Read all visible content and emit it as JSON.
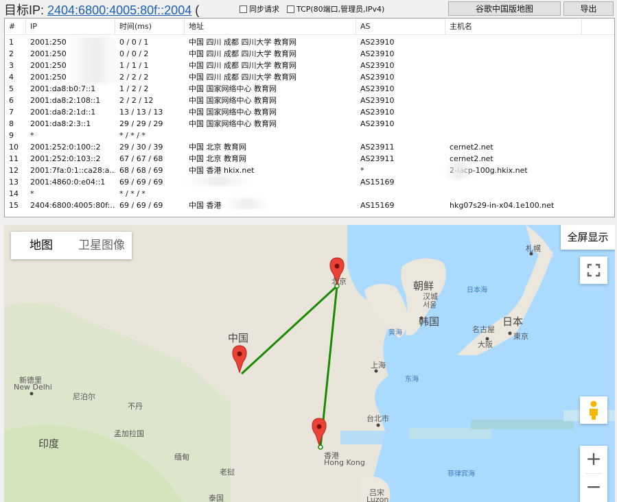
{
  "header": {
    "target_prefix": "目标IP: ",
    "target_ip": "2404:6800:4005:80f::2004",
    "target_suffix": " (",
    "sync_label": "同步请求",
    "tcp_label": "TCP(80端口,管理员,IPv4)",
    "map_button": "谷歌中国版地图",
    "export_button": "导出"
  },
  "table": {
    "columns": [
      "#",
      "IP",
      "时间(ms)",
      "地址",
      "AS",
      "主机名"
    ],
    "rows": [
      {
        "n": "1",
        "ip": "2001:250",
        "time": "0 / 0 / 1",
        "addr": "中国 四川 成都 四川大学 教育网",
        "as": "AS23910",
        "host": ""
      },
      {
        "n": "2",
        "ip": "2001:250",
        "time": "0 / 0 / 2",
        "addr": "中国 四川 成都 四川大学 教育网",
        "as": "AS23910",
        "host": ""
      },
      {
        "n": "3",
        "ip": "2001:250",
        "time": "1 / 1 / 1",
        "addr": "中国 四川 成都 四川大学 教育网",
        "as": "AS23910",
        "host": ""
      },
      {
        "n": "4",
        "ip": "2001:250",
        "time": "2 / 2 / 2",
        "addr": "中国 四川 成都 四川大学 教育网",
        "as": "AS23910",
        "host": ""
      },
      {
        "n": "5",
        "ip": "2001:da8:b0:7::1",
        "time": "1 / 2 / 2",
        "addr": "中国 国家网络中心 教育网",
        "as": "AS23910",
        "host": ""
      },
      {
        "n": "6",
        "ip": "2001:da8:2:108::1",
        "time": "2 / 2 / 12",
        "addr": "中国 国家网络中心 教育网",
        "as": "AS23910",
        "host": ""
      },
      {
        "n": "7",
        "ip": "2001:da8:2:1d::1",
        "time": "13 / 13 / 13",
        "addr": "中国 国家网络中心 教育网",
        "as": "AS23910",
        "host": ""
      },
      {
        "n": "8",
        "ip": "2001:da8:2:3::1",
        "time": "29 / 29 / 29",
        "addr": "中国 国家网络中心 教育网",
        "as": "AS23910",
        "host": ""
      },
      {
        "n": "9",
        "ip": "*",
        "time": "* / * / *",
        "addr": "",
        "as": "",
        "host": ""
      },
      {
        "n": "10",
        "ip": "2001:252:0:100::2",
        "time": "29 / 30 / 39",
        "addr": "中国 北京 教育网",
        "as": "AS23911",
        "host": "cernet2.net"
      },
      {
        "n": "11",
        "ip": "2001:252:0:103::2",
        "time": "67 / 67 / 68",
        "addr": "中国 北京 教育网",
        "as": "AS23911",
        "host": "cernet2.net"
      },
      {
        "n": "12",
        "ip": "2001:7fa:0:1::ca28:a...",
        "time": "68 / 68 / 69",
        "addr": "中国 香港 hkix.net",
        "as": "*",
        "host": "2-lacp-100g.hkix.net"
      },
      {
        "n": "13",
        "ip": "2001:4860:0:e04::1",
        "time": "69 / 69 / 69",
        "addr": "",
        "as": "AS15169",
        "host": ""
      },
      {
        "n": "14",
        "ip": "*",
        "time": "* / * / *",
        "addr": "",
        "as": "",
        "host": ""
      },
      {
        "n": "15",
        "ip": "2404:6800:4005:80f:...",
        "time": "69 / 69 / 69",
        "addr": "中国 香港",
        "as": "AS15169",
        "host": "hkg07s29-in-x04.1e100.net"
      }
    ]
  },
  "map": {
    "type_map": "地图",
    "type_satellite": "卫星图像",
    "fullscreen": "全屏显示",
    "zoom_in": "+",
    "zoom_out": "−",
    "labels": {
      "china": "中国",
      "india": "印度",
      "nepal": "尼泊尔",
      "bhutan": "不丹",
      "bangladesh": "孟加拉国",
      "myanmar": "缅甸",
      "laos": "老挝",
      "thailand": "泰国",
      "new_delhi": "新德里",
      "new_delhi_en": "New Delhi",
      "beijing": "北京",
      "north_korea": "朝鲜",
      "seoul": "汉城",
      "seoul2": "서울",
      "korea": "韩国",
      "japan_sea": "日本海",
      "japan": "日本",
      "nagoya": "名古屋",
      "osaka": "大阪",
      "tokyo": "東京",
      "sapporo": "札幌",
      "yellow_sea": "黄海",
      "east_sea": "东海",
      "shanghai": "上海",
      "taipei": "台北市",
      "hongkong": "香港",
      "hongkong_en": "Hong Kong",
      "philippine_sea": "菲律宾海",
      "luzon": "吕宋",
      "luzon_en": "Luzon"
    },
    "route_color": "#1a8a00",
    "marker_color": "#ea4335",
    "water_color": "#aadaff"
  }
}
